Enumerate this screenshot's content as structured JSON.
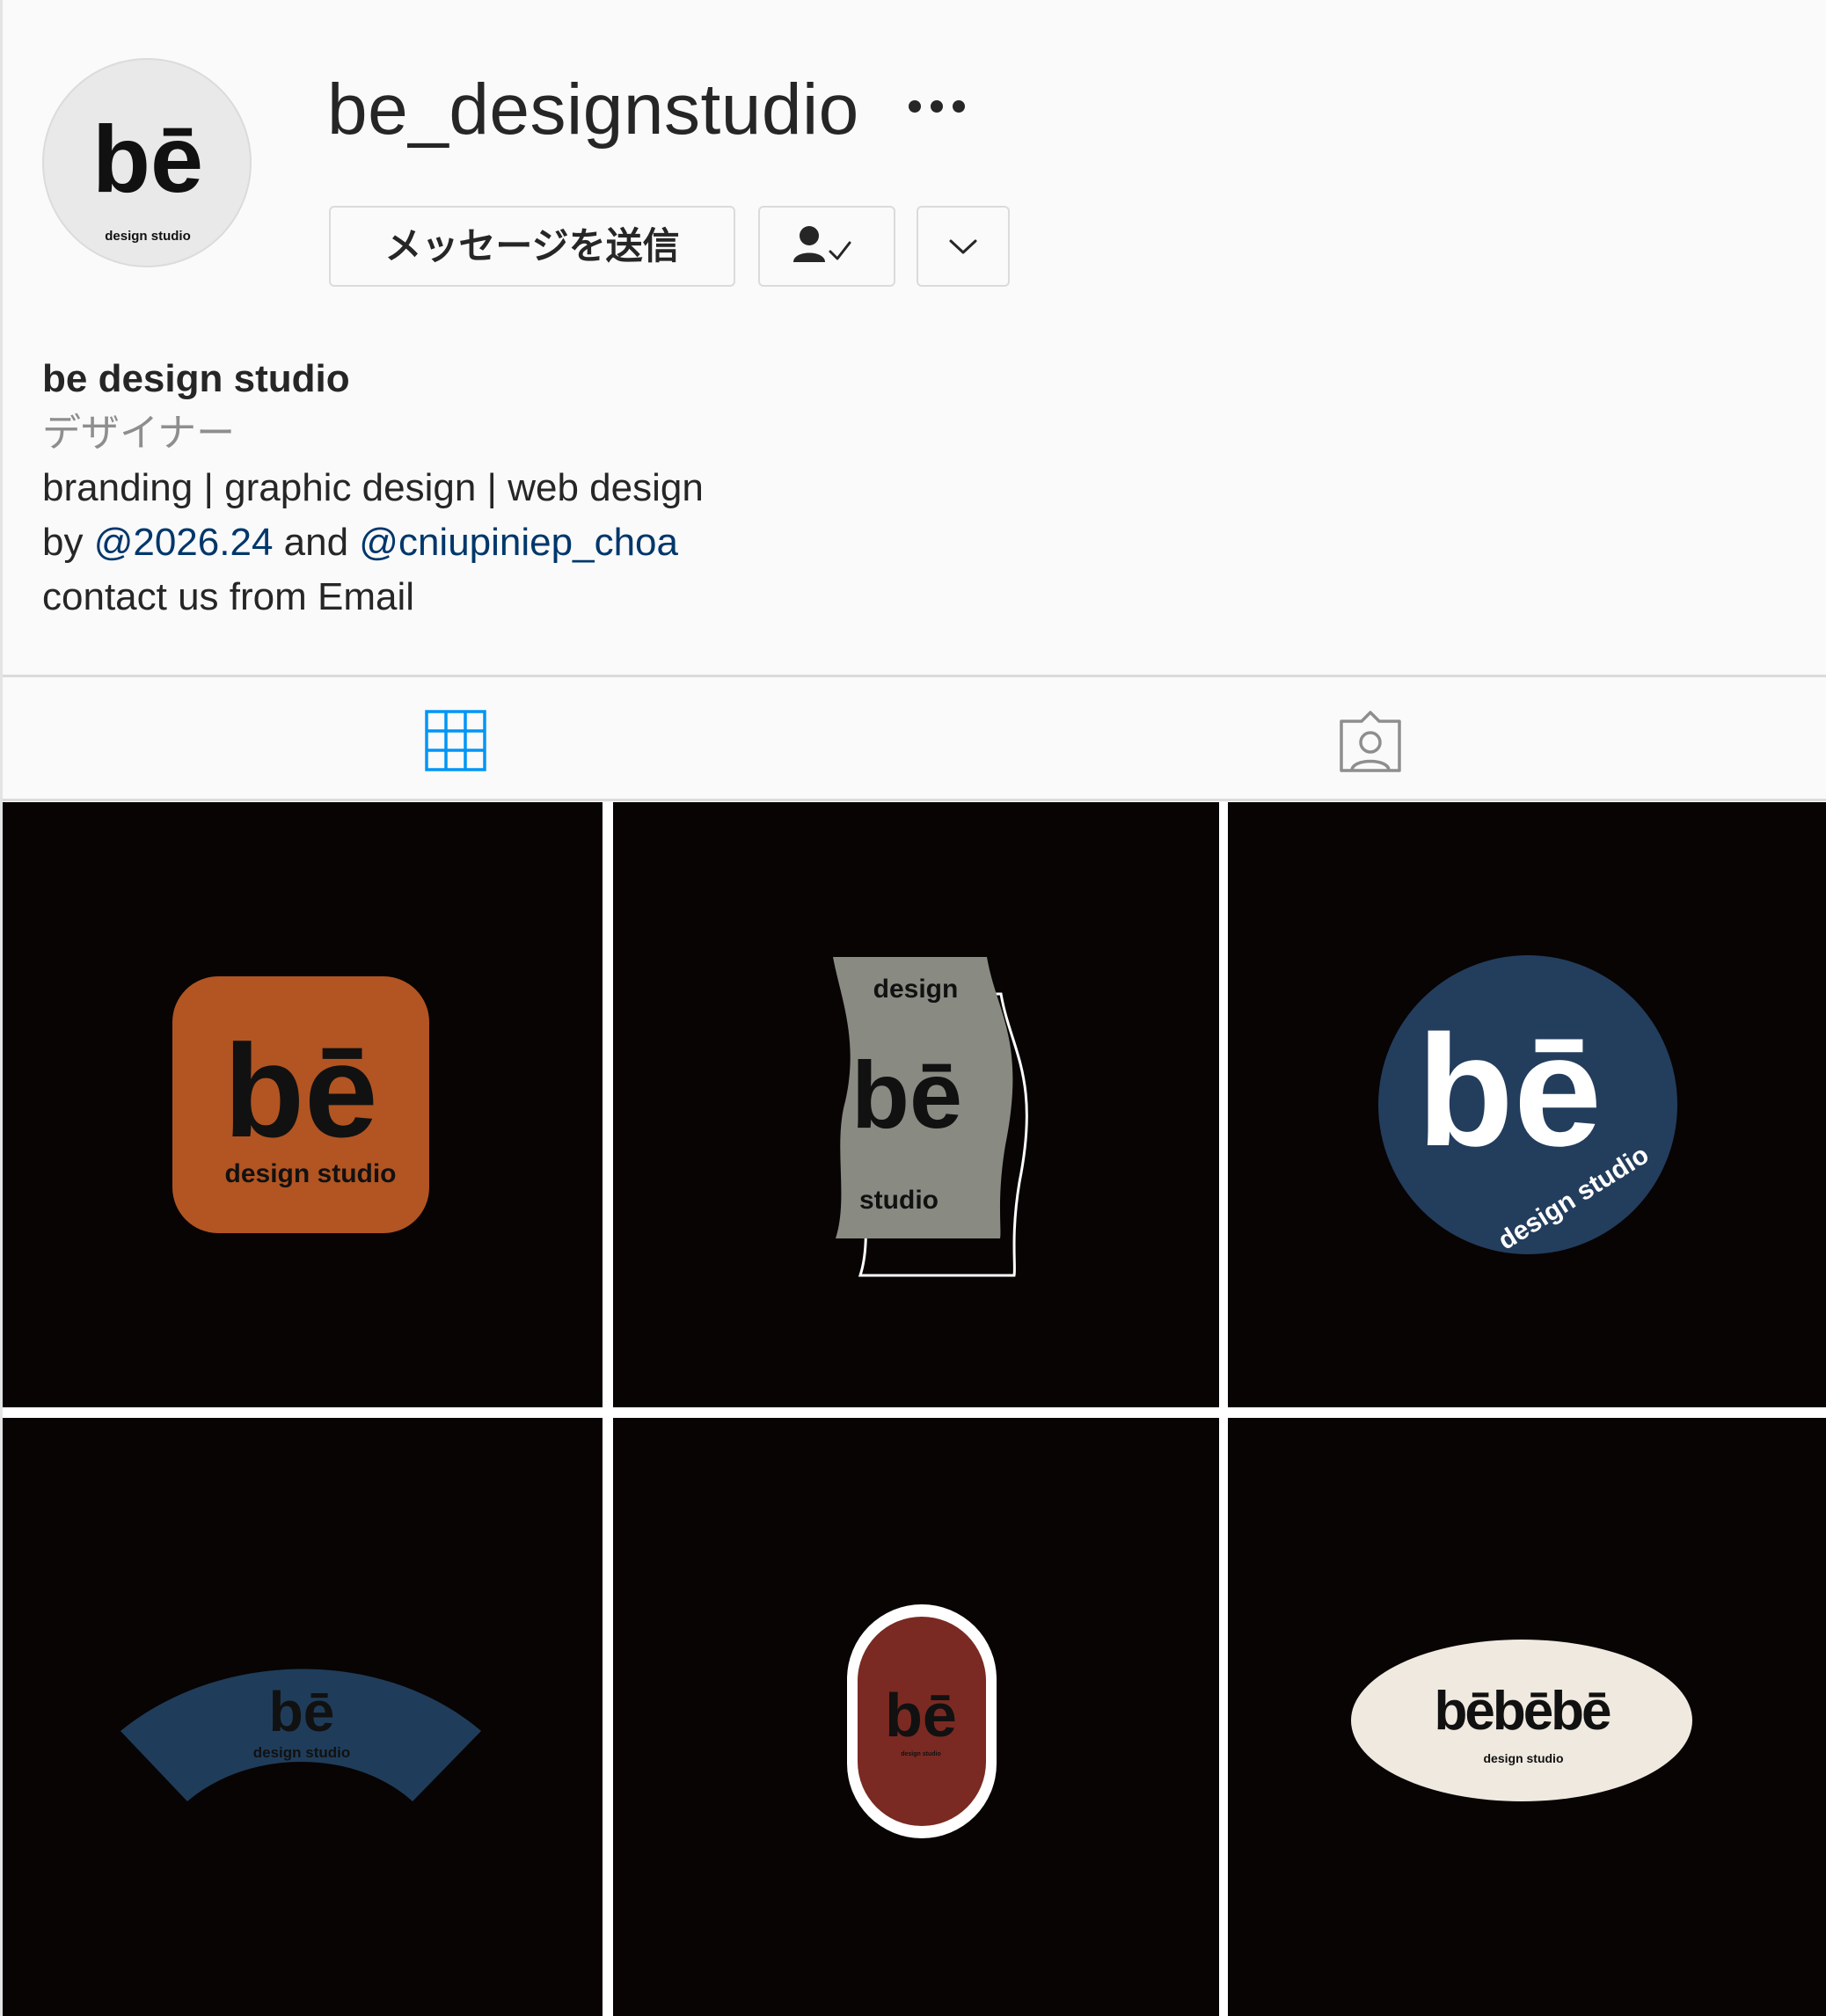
{
  "profile": {
    "username": "be_designstudio",
    "avatar_logo": "bē",
    "avatar_tagline": "design studio"
  },
  "actions": {
    "message_label": "メッセージを送信",
    "following_icon": "person-check-icon",
    "dropdown_icon": "chevron-down-icon",
    "more_icon": "more-horizontal-icon"
  },
  "bio": {
    "name": "be design studio",
    "category": "デザイナー",
    "line1": "branding | graphic design | web design",
    "line2_prefix": "by ",
    "mention1": "@2026.24",
    "line2_mid": " and ",
    "mention2": "@cniupiniep_choa",
    "line3": "contact us from Email"
  },
  "tabs": {
    "posts_icon": "grid-icon",
    "tagged_icon": "tagged-user-icon",
    "active_color": "#0095f6"
  },
  "posts": [
    {
      "logo": "bē",
      "tagline": "design studio",
      "shape": "rounded-square",
      "color": "#b25522"
    },
    {
      "logo": "bē",
      "top": "design",
      "bottom": "studio",
      "shape": "wavy-banner",
      "color": "#898a82"
    },
    {
      "logo": "bē",
      "tagline": "design studio",
      "shape": "circle",
      "color": "#233d5d"
    },
    {
      "logo": "bē",
      "tagline": "design studio",
      "shape": "arc-banner",
      "color": "#1f3d5a"
    },
    {
      "logo": "bē",
      "tagline": "design studio",
      "shape": "pill",
      "color": "#7a2a22"
    },
    {
      "logo": "bēbēbē",
      "tagline": "design studio",
      "shape": "ellipse",
      "color": "#efe9df"
    }
  ]
}
